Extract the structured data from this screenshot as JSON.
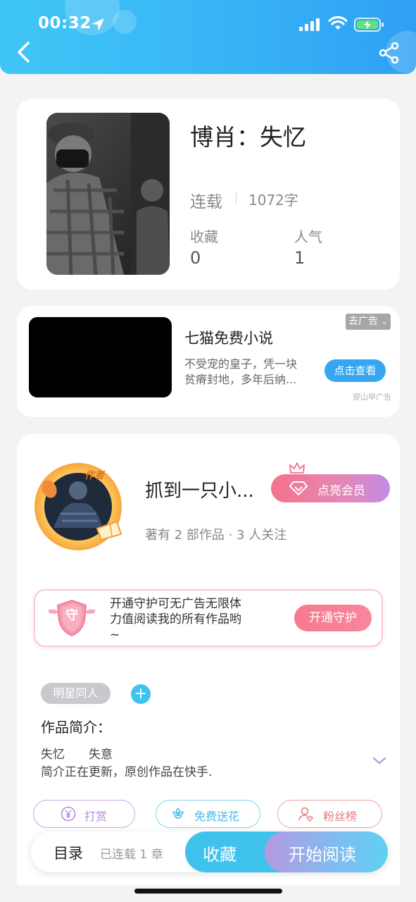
{
  "status_bar": {
    "time": "00:32"
  },
  "book": {
    "title": "博肖：失忆",
    "status": "连载",
    "word_count": "1072字",
    "favorites_label": "收藏",
    "favorites_value": "0",
    "popularity_label": "人气",
    "popularity_value": "1"
  },
  "ad": {
    "title": "七猫免费小说",
    "desc_line1": "不受宠的皇子，凭一块",
    "desc_line2": "贫瘠封地，多年后纳...",
    "close_label": "去广告",
    "cta": "点击查看",
    "source": "穿山甲广告"
  },
  "author": {
    "badge": "作者",
    "name": "抓到一只小...",
    "vip_button": "点亮会员",
    "meta": "著有 2 部作品 · 3 人关注"
  },
  "guard": {
    "icon_char": "守",
    "text_line1": "开通守护可无广告无限体",
    "text_line2": "力值阅读我的所有作品哟",
    "text_line3": "~",
    "button": "开通守护"
  },
  "tags": {
    "items": [
      "明星同人"
    ],
    "add_label": "+"
  },
  "intro": {
    "title": "作品简介：",
    "line1": "失忆　　失意",
    "line2": "简介正在更新，原创作品在快手."
  },
  "actions": {
    "reward": "打赏",
    "flower": "免费送花",
    "fans": "粉丝榜"
  },
  "bottom": {
    "toc": "目录",
    "chapters": "已连载 1 章",
    "favorite": "收藏",
    "start_read": "开始阅读"
  },
  "colors": {
    "header_blue": "#38b4f6",
    "accent_cyan": "#3fc2ec",
    "vip_pink": "#f5728c",
    "vip_purple": "#c28be6",
    "reward_purple": "#b38be0",
    "flower_blue": "#5ac7ee",
    "fans_red": "#e57d7d"
  },
  "icons": [
    "location-arrow-icon",
    "signal-icon",
    "wifi-icon",
    "battery-charging-icon",
    "back-arrow-icon",
    "share-icon",
    "diamond-icon",
    "crown-icon",
    "shield-icon",
    "chevron-down-icon",
    "yen-icon",
    "flower-icon",
    "user-heart-icon"
  ]
}
